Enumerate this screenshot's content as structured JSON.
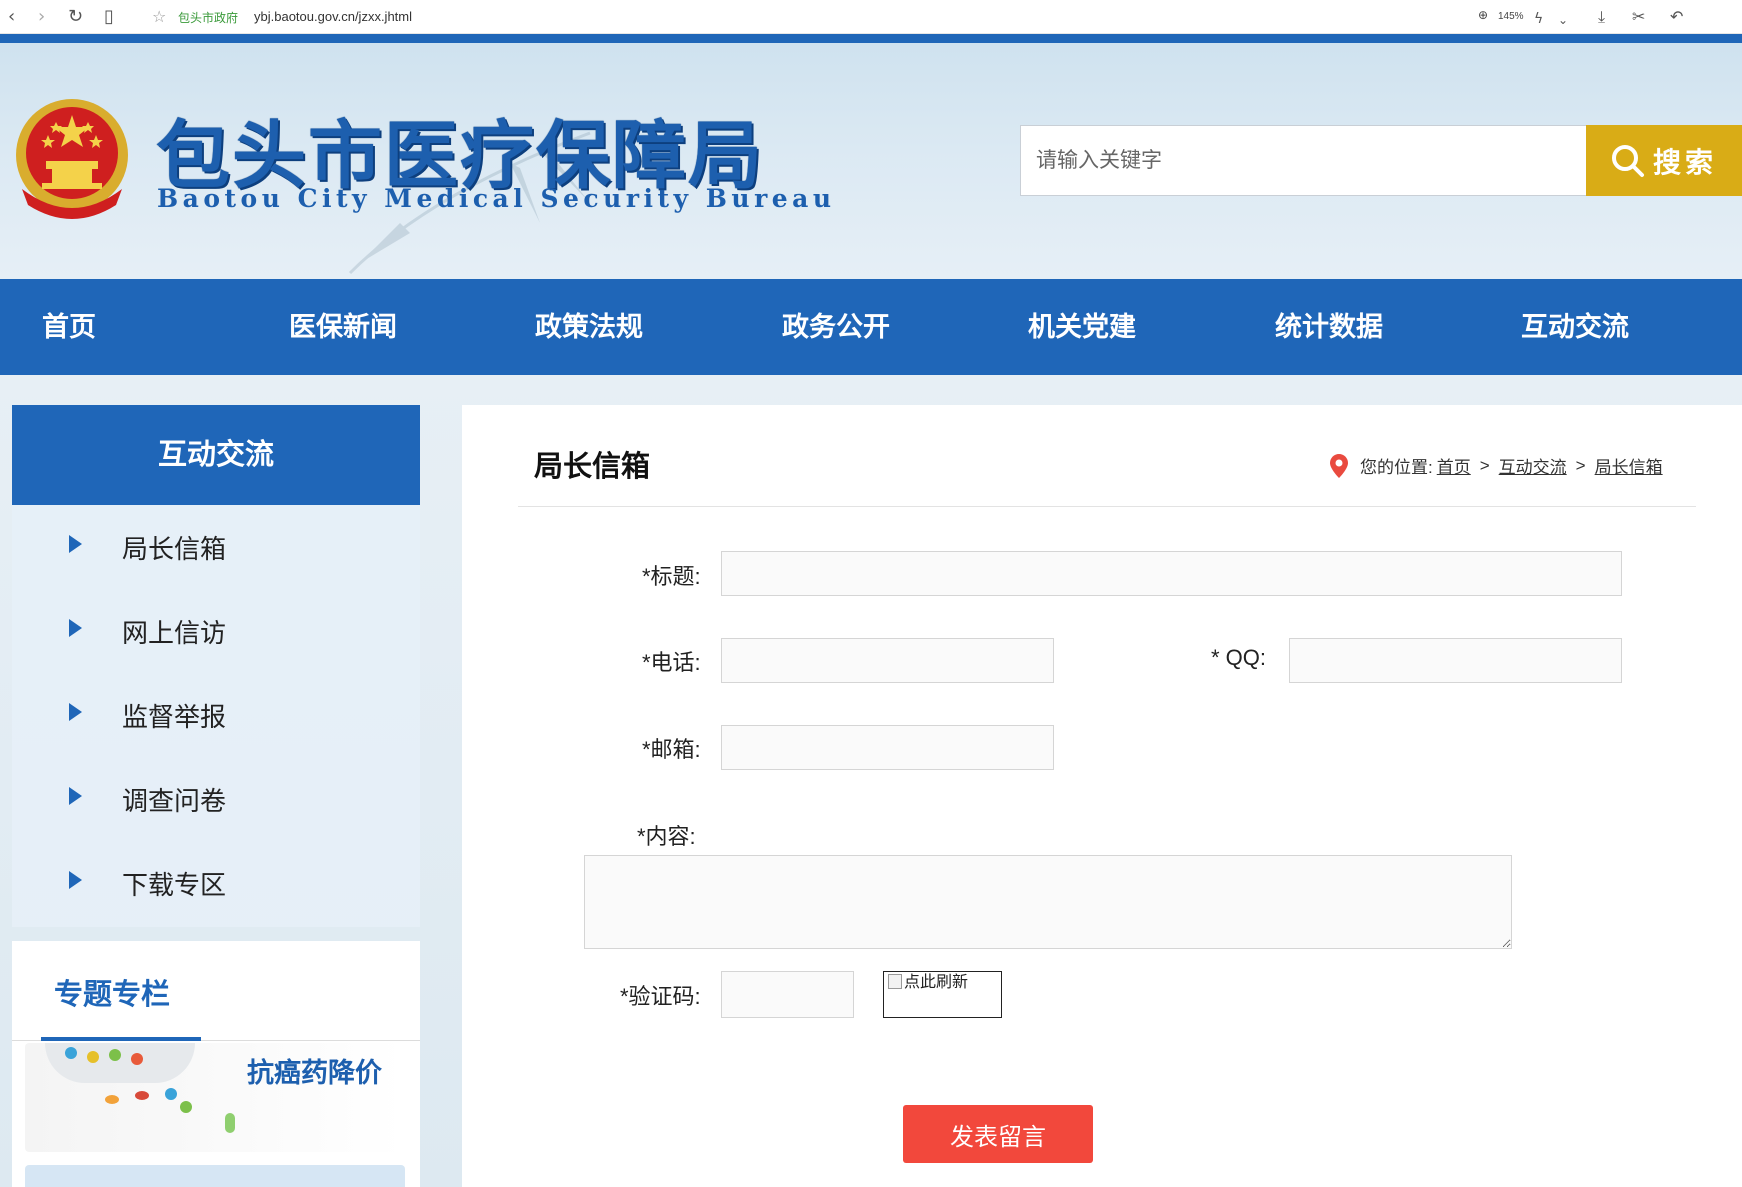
{
  "browser": {
    "site_name": "包头市政府",
    "url": "ybj.baotou.gov.cn/jzxx.jhtml",
    "zoom": "145%"
  },
  "header": {
    "title": "包头市医疗保障局",
    "subtitle": "Baotou City Medical Security Bureau",
    "search_placeholder": "请输入关键字",
    "search_button": "搜索"
  },
  "nav": {
    "items": [
      "首页",
      "医保新闻",
      "政策法规",
      "政务公开",
      "机关党建",
      "统计数据",
      "互动交流"
    ]
  },
  "sidebar": {
    "heading": "互动交流",
    "items": [
      "局长信箱",
      "网上信访",
      "监督举报",
      "调查问卷",
      "下载专区"
    ],
    "topic_heading": "专题专栏",
    "topic_card": "抗癌药降价"
  },
  "main": {
    "title": "局长信箱",
    "breadcrumb": {
      "prefix": "您的位置:",
      "links": [
        "首页",
        "互动交流",
        "局长信箱"
      ],
      "sep": ">"
    },
    "form": {
      "title_label": "*标题:",
      "phone_label": "*电话:",
      "qq_label": "* QQ:",
      "email_label": "*邮箱:",
      "content_label": "*内容:",
      "captcha_label": "*验证码:",
      "captcha_alt": "点此刷新",
      "submit": "发表留言"
    }
  },
  "colors": {
    "primary_blue": "#1f66b8",
    "search_gold": "#d9ac16",
    "submit_red": "#f2483c"
  }
}
